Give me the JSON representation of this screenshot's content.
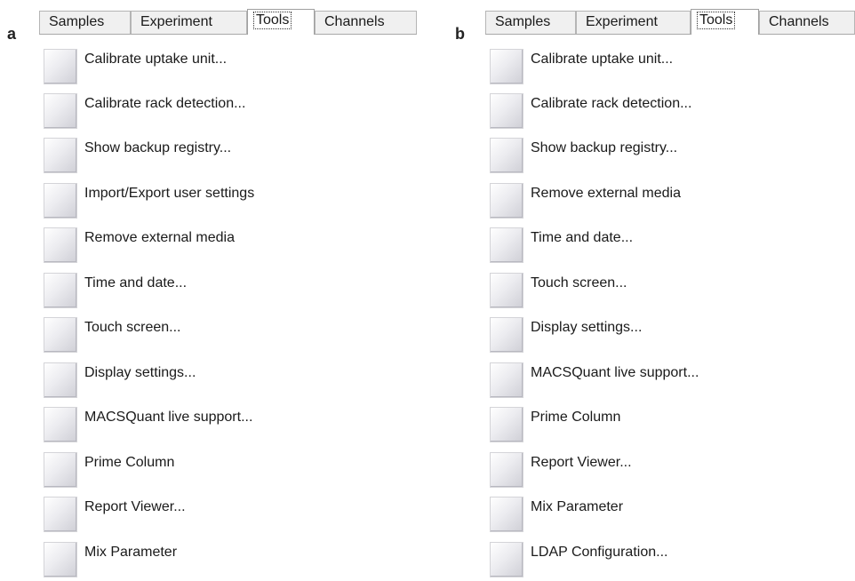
{
  "panels": [
    {
      "letter": "a",
      "tabs": [
        "Samples",
        "Experiment",
        "Tools",
        "Channels"
      ],
      "active_tab": "Tools",
      "items": [
        "Calibrate uptake unit...",
        "Calibrate rack detection...",
        "Show backup registry...",
        "Import/Export user settings",
        "Remove external media",
        "Time and date...",
        "Touch screen...",
        "Display settings...",
        "MACSQuant live support...",
        "Prime Column",
        "Report Viewer...",
        "Mix Parameter"
      ]
    },
    {
      "letter": "b",
      "tabs": [
        "Samples",
        "Experiment",
        "Tools",
        "Channels"
      ],
      "active_tab": "Tools",
      "items": [
        "Calibrate uptake unit...",
        "Calibrate rack detection...",
        "Show backup registry...",
        "Remove external media",
        "Time and date...",
        "Touch screen...",
        "Display settings...",
        "MACSQuant live support...",
        "Prime Column",
        "Report Viewer...",
        "Mix Parameter",
        "LDAP Configuration..."
      ]
    }
  ]
}
